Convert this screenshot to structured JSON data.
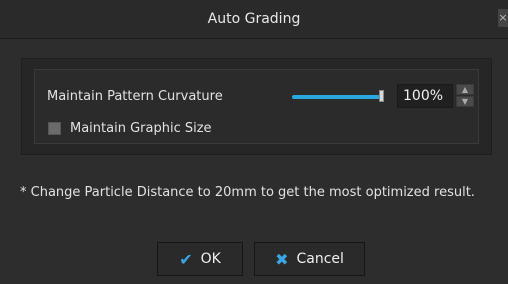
{
  "window": {
    "title": "Auto Grading",
    "close_glyph": "×"
  },
  "options": {
    "curvature_label": "Maintain Pattern Curvature",
    "curvature_value": "100%",
    "curvature_level_percent": 100,
    "graphic_size_label": "Maintain Graphic Size",
    "graphic_size_checked": false
  },
  "note": "* Change Particle Distance to 20mm to get the most optimized result.",
  "buttons": {
    "ok_label": "OK",
    "ok_icon": "checkmark-icon",
    "cancel_label": "Cancel",
    "cancel_icon": "x-icon"
  },
  "colors": {
    "accent": "#29a8e0",
    "background": "#2d2d2d"
  }
}
